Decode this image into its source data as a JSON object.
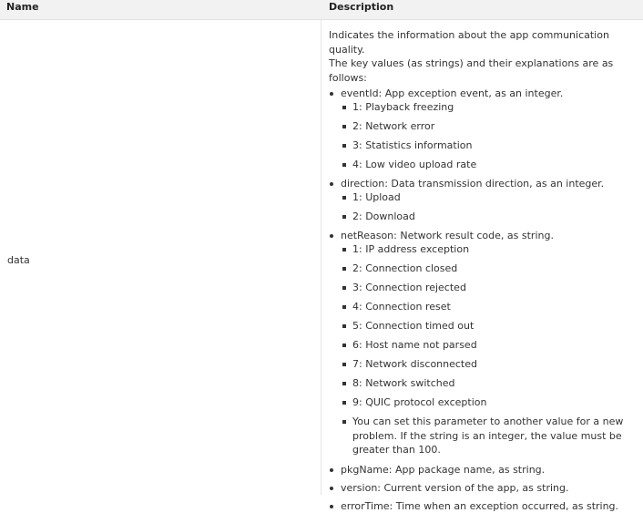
{
  "header": {
    "name": "Name",
    "description": "Description"
  },
  "row": {
    "name": "data",
    "intro_1": "Indicates the information about the app communication quality.",
    "intro_2": "The key values (as strings) and their explanations are as follows:",
    "fields": [
      {
        "text": "eventId: App exception event, as an integer.",
        "codes": [
          {
            "code": "1",
            "label": ": Playback freezing"
          },
          {
            "code": "2",
            "label": ": Network error"
          },
          {
            "code": "3",
            "label": ": Statistics information"
          },
          {
            "code": "4",
            "label": ": Low video upload rate"
          }
        ]
      },
      {
        "text": "direction: Data transmission direction, as an integer.",
        "codes": [
          {
            "code": "1",
            "label": ": Upload"
          },
          {
            "code": "2",
            "label": ": Download"
          }
        ]
      },
      {
        "text": "netReason: Network result code, as string.",
        "codes": [
          {
            "code": "1",
            "label": ": IP address exception"
          },
          {
            "code": "2",
            "label": ": Connection closed"
          },
          {
            "code": "3",
            "label": ": Connection rejected"
          },
          {
            "code": "4",
            "label": ": Connection reset"
          },
          {
            "code": "5",
            "label": ": Connection timed out"
          },
          {
            "code": "6",
            "label": ": Host name not parsed"
          },
          {
            "code": "7",
            "label": ": Network disconnected"
          },
          {
            "code": "8",
            "label": ": Network switched"
          },
          {
            "code": "9",
            "label": ": QUIC protocol exception"
          }
        ],
        "note": "You can set this parameter to another value for a new problem. If the string is an integer, the value must be greater than 100."
      },
      {
        "text": "pkgName: App package name, as string."
      },
      {
        "text": "version: Current version of the app, as string."
      },
      {
        "text": "errorTime: Time when an exception occurred, as string."
      }
    ]
  }
}
